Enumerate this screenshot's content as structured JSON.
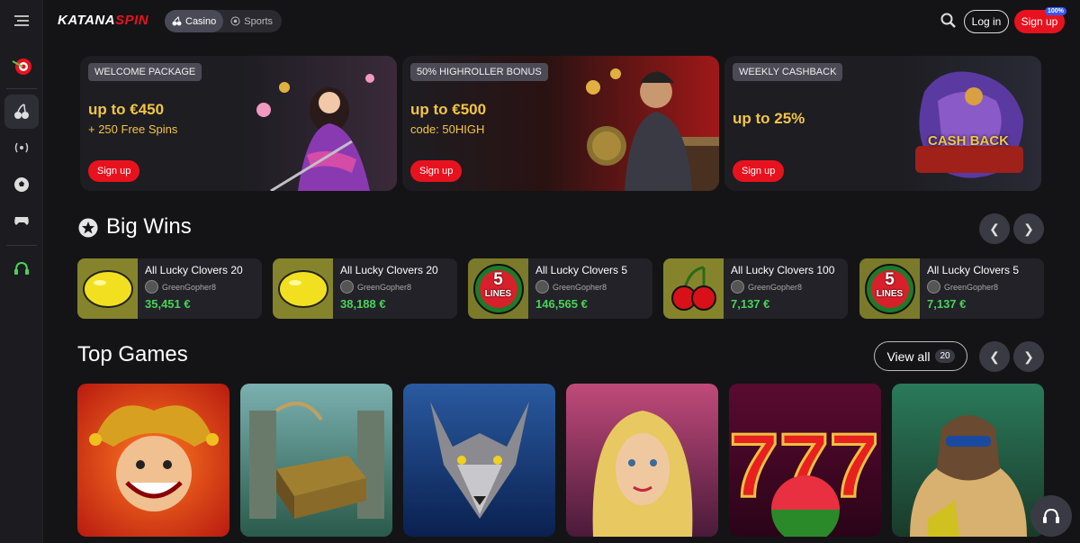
{
  "brand": {
    "part1": "KATANA",
    "part2": "SPIN"
  },
  "modes": [
    {
      "label": "Casino"
    },
    {
      "label": "Sports"
    }
  ],
  "header": {
    "login": "Log in",
    "signup": "Sign up",
    "signup_badge": "100%"
  },
  "promos": [
    {
      "tag": "WELCOME PACKAGE",
      "line1": "up to €450",
      "line2": "+ 250 Free Spins",
      "button": "Sign up"
    },
    {
      "tag": "50% HIGHROLLER BONUS",
      "line1": "up to €500",
      "line2": "code: 50HIGH",
      "button": "Sign up"
    },
    {
      "tag": "WEEKLY CASHBACK",
      "line1": "up to 25%",
      "line2": "",
      "button": "Sign up",
      "art_text": "CASH BACK"
    }
  ],
  "big_wins": {
    "title": "Big Wins",
    "items": [
      {
        "game": "All Lucky Clovers 20",
        "user": "GreenGopher8",
        "amount": "35,451 €",
        "icon": "lemon-icon"
      },
      {
        "game": "All Lucky Clovers 20",
        "user": "GreenGopher8",
        "amount": "38,188 €",
        "icon": "lemon-icon"
      },
      {
        "game": "All Lucky Clovers 5",
        "user": "GreenGopher8",
        "amount": "146,565 €",
        "icon": "watermelon-5-lines-icon",
        "thumb_text1": "5",
        "thumb_text2": "LINES"
      },
      {
        "game": "All Lucky Clovers 100",
        "user": "GreenGopher8",
        "amount": "7,137 €",
        "icon": "cherry-icon"
      },
      {
        "game": "All Lucky Clovers 5",
        "user": "GreenGopher8",
        "amount": "7,137 €",
        "icon": "watermelon-5-lines-icon",
        "thumb_text1": "5",
        "thumb_text2": "LINES"
      }
    ]
  },
  "top_games": {
    "title": "Top Games",
    "view_all": "View all",
    "count": "20",
    "games": [
      {
        "art": "jester",
        "bg": "#c92a14"
      },
      {
        "art": "treasure-chest",
        "bg": "#3d6a6a"
      },
      {
        "art": "wolf",
        "bg": "#1c4a86"
      },
      {
        "art": "blonde-woman",
        "bg": "#8a3a5a"
      },
      {
        "art": "sevens-watermelon",
        "bg": "#5a0a30"
      },
      {
        "art": "rapper",
        "bg": "#2a6a4a"
      }
    ]
  },
  "colors": {
    "accent": "#e8121f",
    "gold": "#f3c544",
    "win_green": "#49d35a",
    "bg": "#141416"
  }
}
